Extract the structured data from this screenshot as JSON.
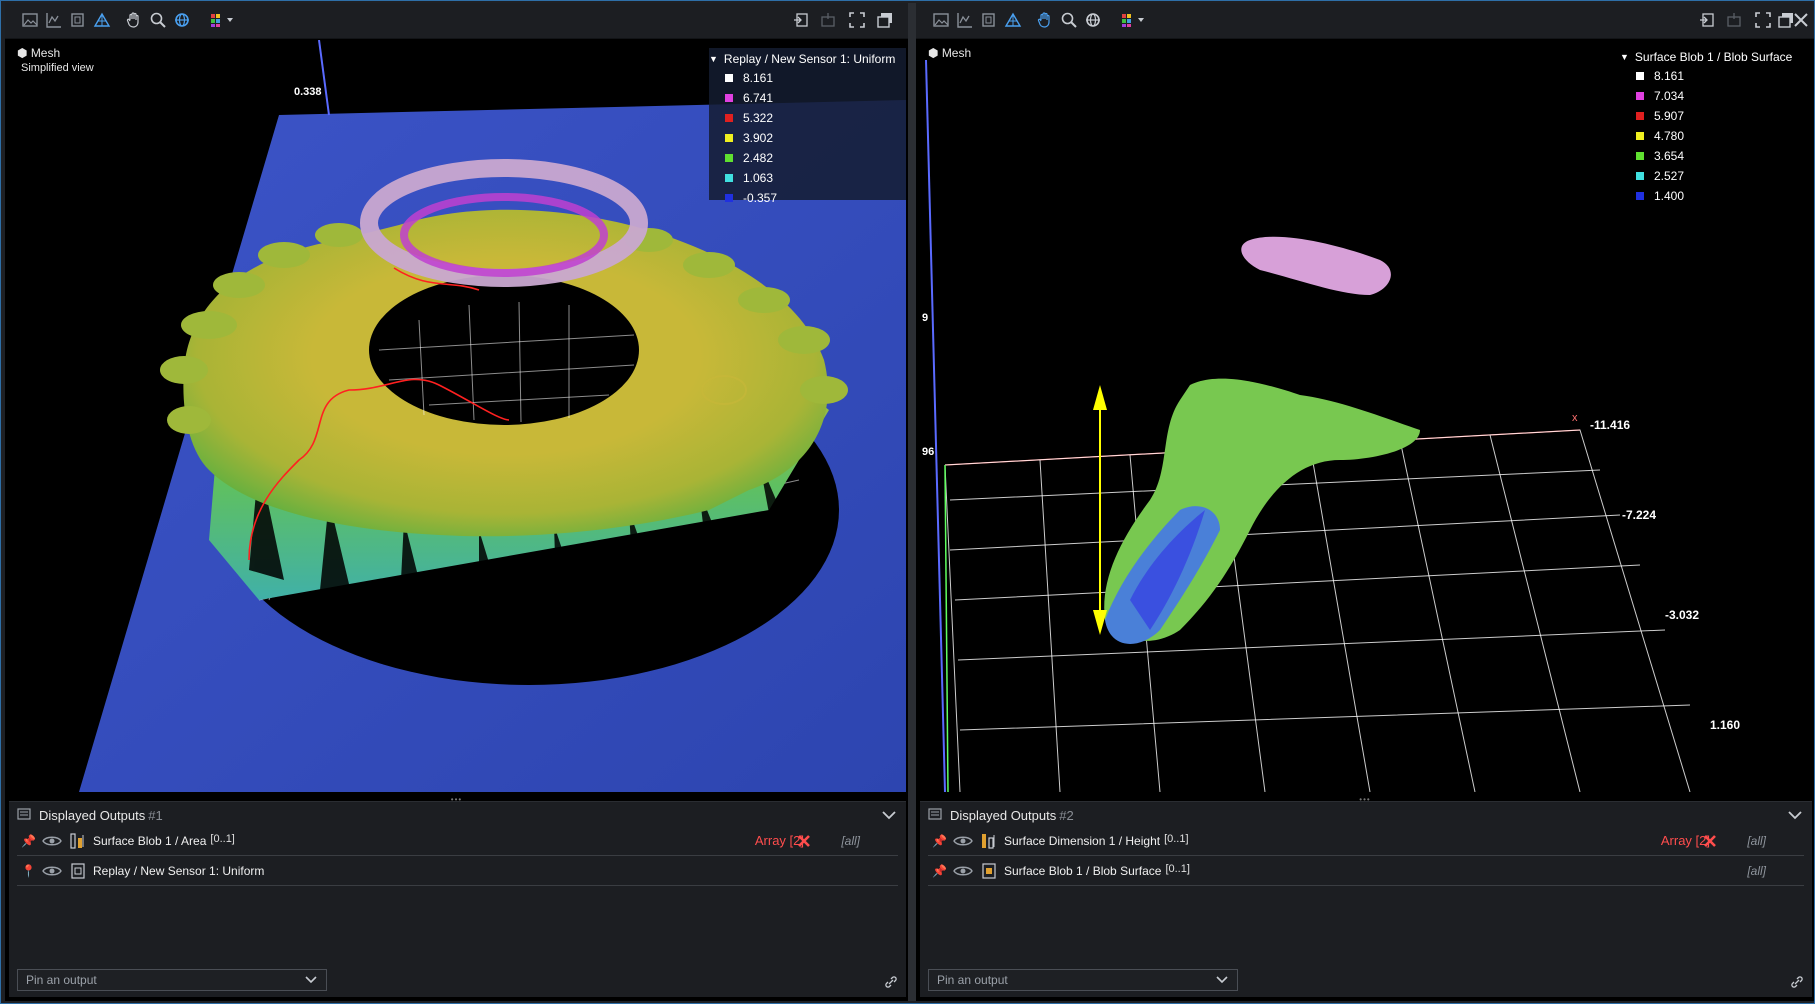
{
  "left": {
    "view_label": "Mesh",
    "view_sub": "Simplified view",
    "legend_title": "Replay / New Sensor 1: Uniform",
    "legend": [
      {
        "value": "8.161",
        "color": "#ffffff"
      },
      {
        "value": "6.741",
        "color": "#e040e0"
      },
      {
        "value": "5.322",
        "color": "#e02020"
      },
      {
        "value": "3.902",
        "color": "#f0f020"
      },
      {
        "value": "2.482",
        "color": "#60e030"
      },
      {
        "value": "1.063",
        "color": "#40e0e0"
      },
      {
        "value": "-0.357",
        "color": "#2030e0"
      }
    ],
    "axis_top": "0.338",
    "outputs_title": "Displayed Outputs",
    "outputs_index": "#1",
    "rows": [
      {
        "label": "Surface Blob 1 / Area",
        "range": "[0..1]",
        "array": "Array [2]",
        "all": "[all]"
      },
      {
        "label": "Replay / New Sensor 1: Uniform",
        "range": "",
        "array": "",
        "all": ""
      }
    ],
    "pin_placeholder": "Pin an output"
  },
  "right": {
    "view_label": "Mesh",
    "legend_title": "Surface Blob 1 / Blob Surface",
    "legend": [
      {
        "value": "8.161",
        "color": "#ffffff"
      },
      {
        "value": "7.034",
        "color": "#e040e0"
      },
      {
        "value": "5.907",
        "color": "#e02020"
      },
      {
        "value": "4.780",
        "color": "#f0f020"
      },
      {
        "value": "3.654",
        "color": "#60e030"
      },
      {
        "value": "2.527",
        "color": "#40e0e0"
      },
      {
        "value": "1.400",
        "color": "#2030e0"
      }
    ],
    "axis_left_1": "9",
    "axis_left_2": "96",
    "axis_x_letter": "x",
    "axis_nums": [
      "-11.416",
      "-7.224",
      "-3.032",
      "1.160"
    ],
    "outputs_title": "Displayed Outputs",
    "outputs_index": "#2",
    "rows": [
      {
        "label": "Surface Dimension 1 / Height",
        "range": "[0..1]",
        "array": "Array [2]",
        "all": "[all]"
      },
      {
        "label": "Surface Blob 1 / Blob Surface",
        "range": "[0..1]",
        "array": "",
        "all": "[all]"
      }
    ],
    "pin_placeholder": "Pin an output"
  },
  "toolbar_icons": [
    "image-icon",
    "profile-icon",
    "depth-icon",
    "mesh-icon",
    "pan-hand-icon",
    "zoom-icon",
    "rotate-icon",
    "colormap-icon"
  ],
  "toolbar_right_icons": [
    "sync-view-icon",
    "fit-icon",
    "fullscreen-icon",
    "float-window-icon"
  ],
  "colors": {
    "accent": "#2e6fa8",
    "error": "#ff4d4d",
    "pin": "#3c8ee0"
  }
}
